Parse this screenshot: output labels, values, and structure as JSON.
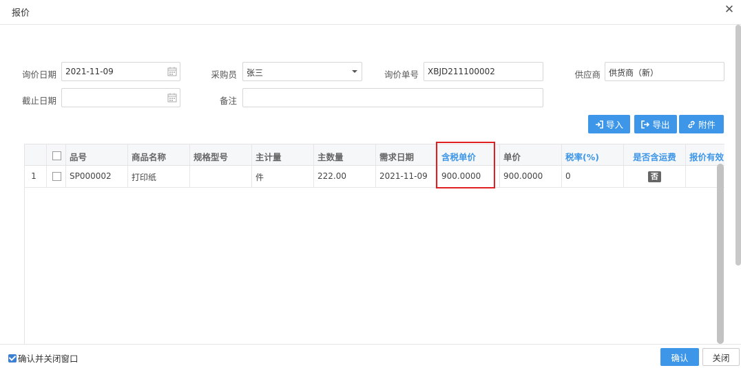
{
  "dialog": {
    "title": "报价",
    "close_icon": "close-icon"
  },
  "form": {
    "inquiry_date_label": "询价日期",
    "inquiry_date_value": "2021-11-09",
    "buyer_label": "采购员",
    "buyer_value": "张三",
    "inquiry_no_label": "询价单号",
    "inquiry_no_value": "XBJD211100002",
    "supplier_label": "供应商",
    "supplier_value": "供货商（新）",
    "deadline_label": "截止日期",
    "deadline_value": "",
    "remark_label": "备注",
    "remark_value": ""
  },
  "toolbar": {
    "import_label": "导入",
    "export_label": "导出",
    "attach_label": "附件"
  },
  "table": {
    "headers": [
      "品号",
      "商品名称",
      "规格型号",
      "主计量",
      "主数量",
      "需求日期",
      "含税单价",
      "单价",
      "税率(%)",
      "是否含运费",
      "报价有效"
    ],
    "rows": [
      {
        "index": "1",
        "item_no": "SP000002",
        "name": "打印纸",
        "spec": "",
        "unit": "件",
        "qty": "222.00",
        "req_date": "2021-11-09",
        "price_tax": "900.0000",
        "price": "900.0000",
        "tax_rate": "0",
        "freight": "否",
        "valid": ""
      }
    ]
  },
  "footer": {
    "confirm_close_label": "确认并关闭窗口",
    "ok_label": "确认",
    "close_label": "关闭"
  },
  "colors": {
    "accent": "#3d96e8",
    "highlight": "#e02020"
  }
}
